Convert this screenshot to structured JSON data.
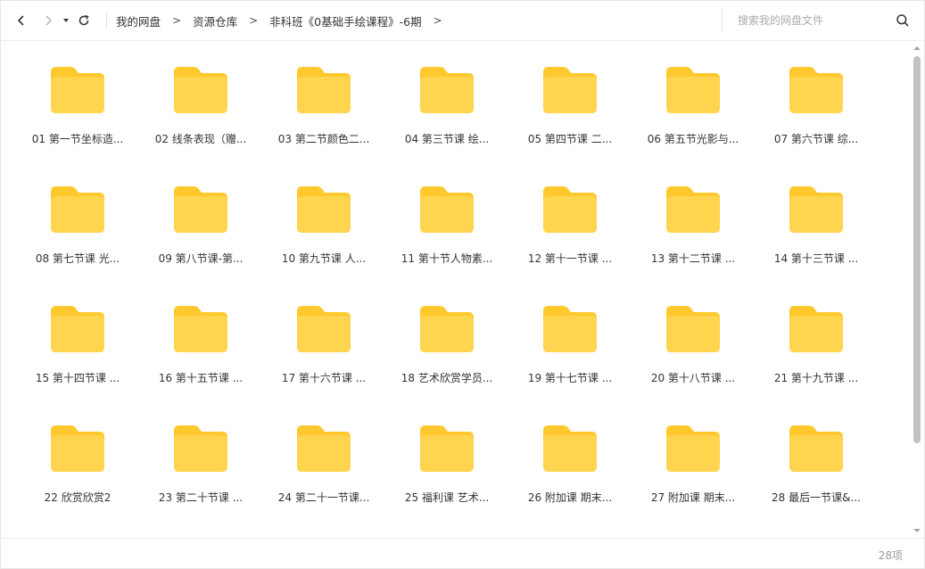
{
  "toolbar": {
    "back_icon": "chevron-left-icon",
    "forward_icon": "chevron-right-icon",
    "history_icon": "caret-down-icon",
    "refresh_icon": "refresh-icon"
  },
  "breadcrumb": {
    "items": [
      "我的网盘",
      "资源仓库",
      "非科班《0基础手绘课程》-6期"
    ],
    "separator": ">"
  },
  "search": {
    "placeholder": "搜索我的网盘文件",
    "icon": "search-icon"
  },
  "folder_color": "#FFD44F",
  "folder_tab_color": "#FFC82C",
  "folders": [
    "01 第一节坐标造...",
    "02 线条表现（赠...",
    "03 第二节颜色二...",
    "04 第三节课  绘...",
    "05 第四节课 二...",
    "06 第五节光影与...",
    "07 第六节课 综...",
    "08 第七节课   光...",
    "09 第八节课-第...",
    "10 第九节课 人...",
    "11 第十节人物素...",
    "12 第十一节课 ...",
    "13 第十二节课  ...",
    "14 第十三节课 ...",
    "15 第十四节课 ...",
    "16 第十五节课 ...",
    "17 第十六节课 ...",
    "18 艺术欣赏学员...",
    "19 第十七节课 ...",
    "20 第十八节课 ...",
    "21 第十九节课 ...",
    "22 欣赏欣赏2",
    "23 第二十节课 ...",
    "24 第二十一节课...",
    "25 福利课 艺术...",
    "26 附加课 期末...",
    "27 附加课 期末...",
    "28 最后一节课&..."
  ],
  "status": {
    "item_count": "28项"
  }
}
